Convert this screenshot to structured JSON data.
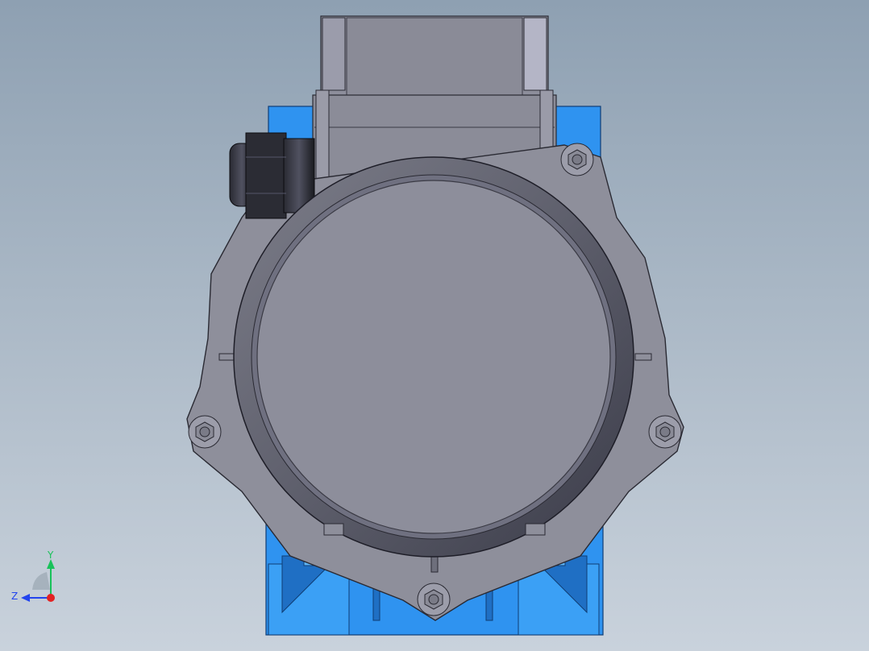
{
  "viewport": {
    "model": "motor-assembly",
    "colors": {
      "background_top": "#8ea0b2",
      "background_bottom": "#c9d2dc",
      "housing": "#8d8e9b",
      "housing_dark": "#6e6f7c",
      "base": "#2f93f0",
      "base_dark": "#1f6fc4",
      "gland": "#1c1d22"
    }
  },
  "triad": {
    "y_label": "Y",
    "z_label": "Z",
    "y_color": "#19c25a",
    "z_color": "#2244ee",
    "x_color": "#e32222"
  }
}
